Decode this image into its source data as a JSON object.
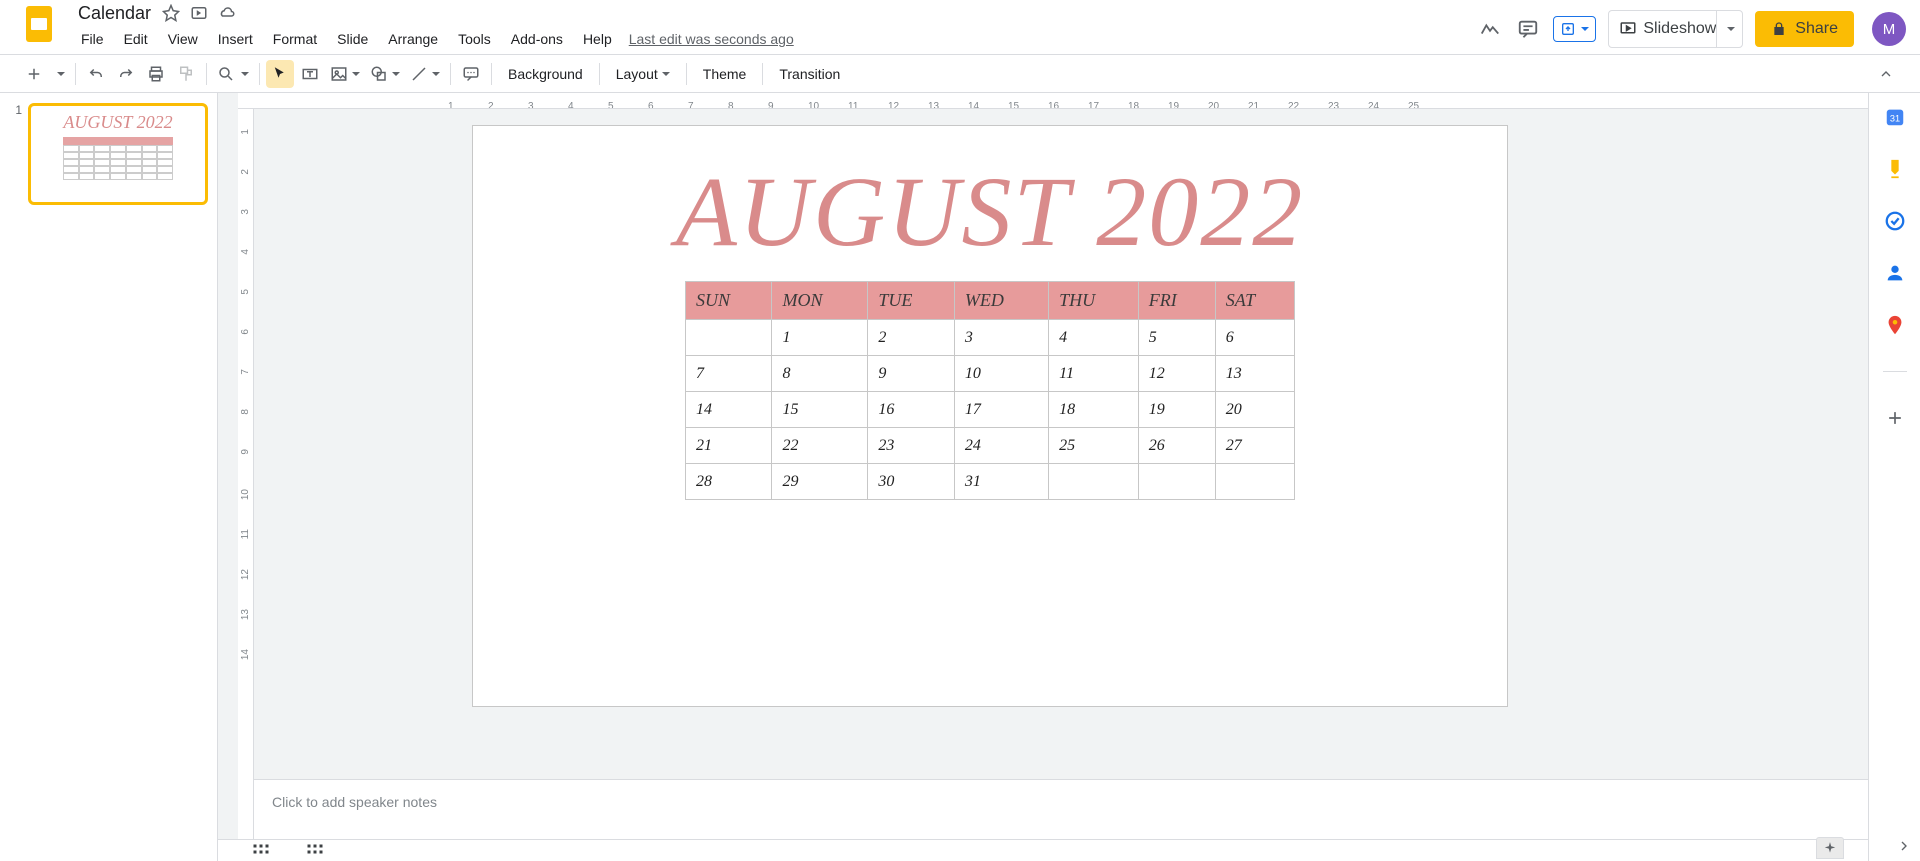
{
  "document": {
    "title": "Calendar",
    "last_edit": "Last edit was seconds ago"
  },
  "menus": [
    "File",
    "Edit",
    "View",
    "Insert",
    "Format",
    "Slide",
    "Arrange",
    "Tools",
    "Add-ons",
    "Help"
  ],
  "header": {
    "slideshow": "Slideshow",
    "share": "Share",
    "avatar_letter": "M"
  },
  "toolbar_text_buttons": {
    "background": "Background",
    "layout": "Layout",
    "theme": "Theme",
    "transition": "Transition"
  },
  "ruler_h": [
    "1",
    "2",
    "3",
    "4",
    "5",
    "6",
    "7",
    "8",
    "9",
    "10",
    "11",
    "12",
    "13",
    "14",
    "15",
    "16",
    "17",
    "18",
    "19",
    "20",
    "21",
    "22",
    "23",
    "24",
    "25"
  ],
  "ruler_v": [
    "1",
    "2",
    "3",
    "4",
    "5",
    "6",
    "7",
    "8",
    "9",
    "10",
    "11",
    "12",
    "13",
    "14"
  ],
  "slide": {
    "title": "AUGUST 2022",
    "days": [
      "SUN",
      "MON",
      "TUE",
      "WED",
      "THU",
      "FRI",
      "SAT"
    ],
    "weeks": [
      [
        "",
        "1",
        "2",
        "3",
        "4",
        "5",
        "6"
      ],
      [
        "7",
        "8",
        "9",
        "10",
        "11",
        "12",
        "13"
      ],
      [
        "14",
        "15",
        "16",
        "17",
        "18",
        "19",
        "20"
      ],
      [
        "21",
        "22",
        "23",
        "24",
        "25",
        "26",
        "27"
      ],
      [
        "28",
        "29",
        "30",
        "31",
        "",
        "",
        ""
      ]
    ]
  },
  "thumbnail": {
    "number": "1"
  },
  "notes_placeholder": "Click to add speaker notes"
}
